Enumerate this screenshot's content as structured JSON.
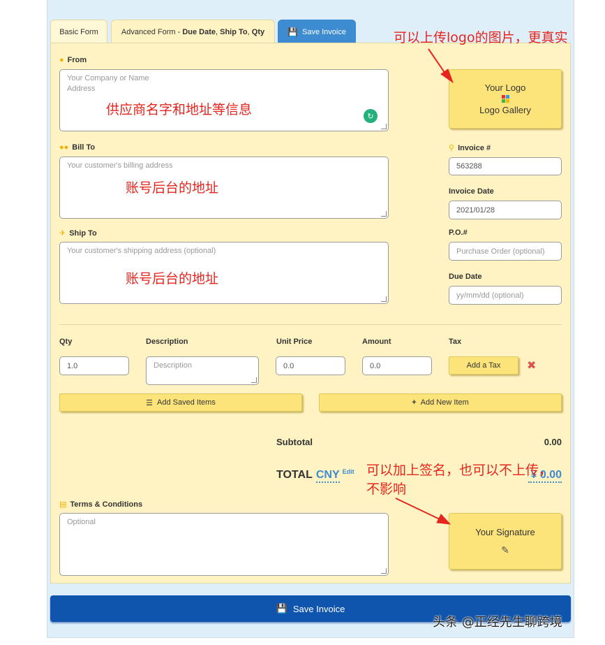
{
  "tabs": {
    "basic": "Basic Form",
    "advanced_prefix": "Advanced Form - ",
    "advanced_bold1": "Due Date",
    "advanced_sep1": ", ",
    "advanced_bold2": "Ship To",
    "advanced_sep2": ", ",
    "advanced_bold3": "Qty",
    "save": "Save Invoice"
  },
  "from": {
    "label": "From",
    "placeholder_line1": "Your Company or Name",
    "placeholder_line2": "Address"
  },
  "bill_to": {
    "label": "Bill To",
    "placeholder": "Your customer's billing address"
  },
  "ship_to": {
    "label": "Ship To",
    "placeholder": "Your customer's shipping address (optional)"
  },
  "logo": {
    "title": "Your Logo",
    "gallery": "Logo Gallery"
  },
  "invoice_meta": {
    "invoice_no_label": "Invoice #",
    "invoice_no_value": "563288",
    "invoice_date_label": "Invoice Date",
    "invoice_date_value": "2021/01/28",
    "po_label": "P.O.#",
    "po_placeholder": "Purchase Order (optional)",
    "due_date_label": "Due Date",
    "due_date_placeholder": "yy/mm/dd (optional)"
  },
  "items": {
    "headers": {
      "qty": "Qty",
      "description": "Description",
      "unit_price": "Unit Price",
      "amount": "Amount",
      "tax": "Tax"
    },
    "row": {
      "qty": "1.0",
      "description_placeholder": "Description",
      "unit_price": "0.0",
      "amount": "0.0"
    },
    "add_tax": "Add a Tax",
    "add_saved": "Add Saved Items",
    "add_new": "Add New Item"
  },
  "totals": {
    "subtotal_label": "Subtotal",
    "subtotal_value": "0.00",
    "total_label": "TOTAL",
    "currency": "CNY",
    "edit": "Edit",
    "total_value": "¥ 0.00"
  },
  "terms": {
    "label": "Terms & Conditions",
    "placeholder": "Optional"
  },
  "signature": {
    "label": "Your Signature"
  },
  "save_bottom": "Save Invoice",
  "annotations": {
    "logo_note": "可以上传logo的图片，更真实",
    "from_note": "供应商名字和地址等信息",
    "bill_note": "账号后台的地址",
    "ship_note": "账号后台的地址",
    "sig_note_line1": "可以加上签名，也可以不上传，",
    "sig_note_line2": "不影响"
  },
  "watermark": "头条 @正经先生聊跨境",
  "colors": {
    "panel": "#fff3c4",
    "accent_blue": "#3d8bd0",
    "button_yellow": "#fde47a",
    "save_bottom": "#0f54ad",
    "annotation_red": "#e5251e"
  }
}
